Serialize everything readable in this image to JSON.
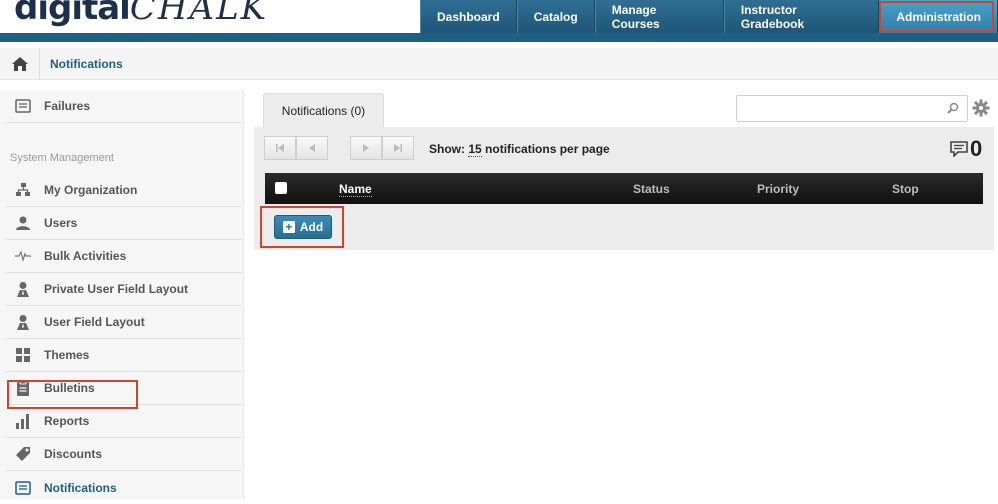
{
  "logo": {
    "part1": "digital",
    "part2": "CHALK"
  },
  "nav": [
    {
      "label": "Dashboard"
    },
    {
      "label": "Catalog"
    },
    {
      "label": "Manage Courses"
    },
    {
      "label": "Instructor Gradebook"
    },
    {
      "label": "Administration",
      "active": true
    }
  ],
  "breadcrumb": {
    "current": "Notifications"
  },
  "sidebar": {
    "top_item": "Failures",
    "section_label": "System Management",
    "items": [
      {
        "label": "My Organization",
        "icon": "org-chart-icon"
      },
      {
        "label": "Users",
        "icon": "user-icon"
      },
      {
        "label": "Bulk Activities",
        "icon": "pulse-icon"
      },
      {
        "label": "Private User Field Layout",
        "icon": "private-user-icon"
      },
      {
        "label": "User Field Layout",
        "icon": "user-field-icon"
      },
      {
        "label": "Themes",
        "icon": "grid-icon"
      },
      {
        "label": "Bulletins",
        "icon": "clipboard-icon"
      },
      {
        "label": "Reports",
        "icon": "bar-chart-icon"
      },
      {
        "label": "Discounts",
        "icon": "tag-icon"
      },
      {
        "label": "Notifications",
        "icon": "notification-icon",
        "active": true
      }
    ]
  },
  "main": {
    "tab_label": "Notifications",
    "tab_count": "(0)",
    "search_placeholder": "",
    "show_prefix": "Show:",
    "per_page": "15",
    "show_suffix": "notifications per page",
    "total_count": "0",
    "columns": {
      "name": "Name",
      "status": "Status",
      "priority": "Priority",
      "stop": "Stop"
    },
    "add_label": "Add"
  },
  "colors": {
    "nav_blue": "#1e5f82",
    "active_tab": "#4aa2cc",
    "highlight": "#d2432e"
  }
}
